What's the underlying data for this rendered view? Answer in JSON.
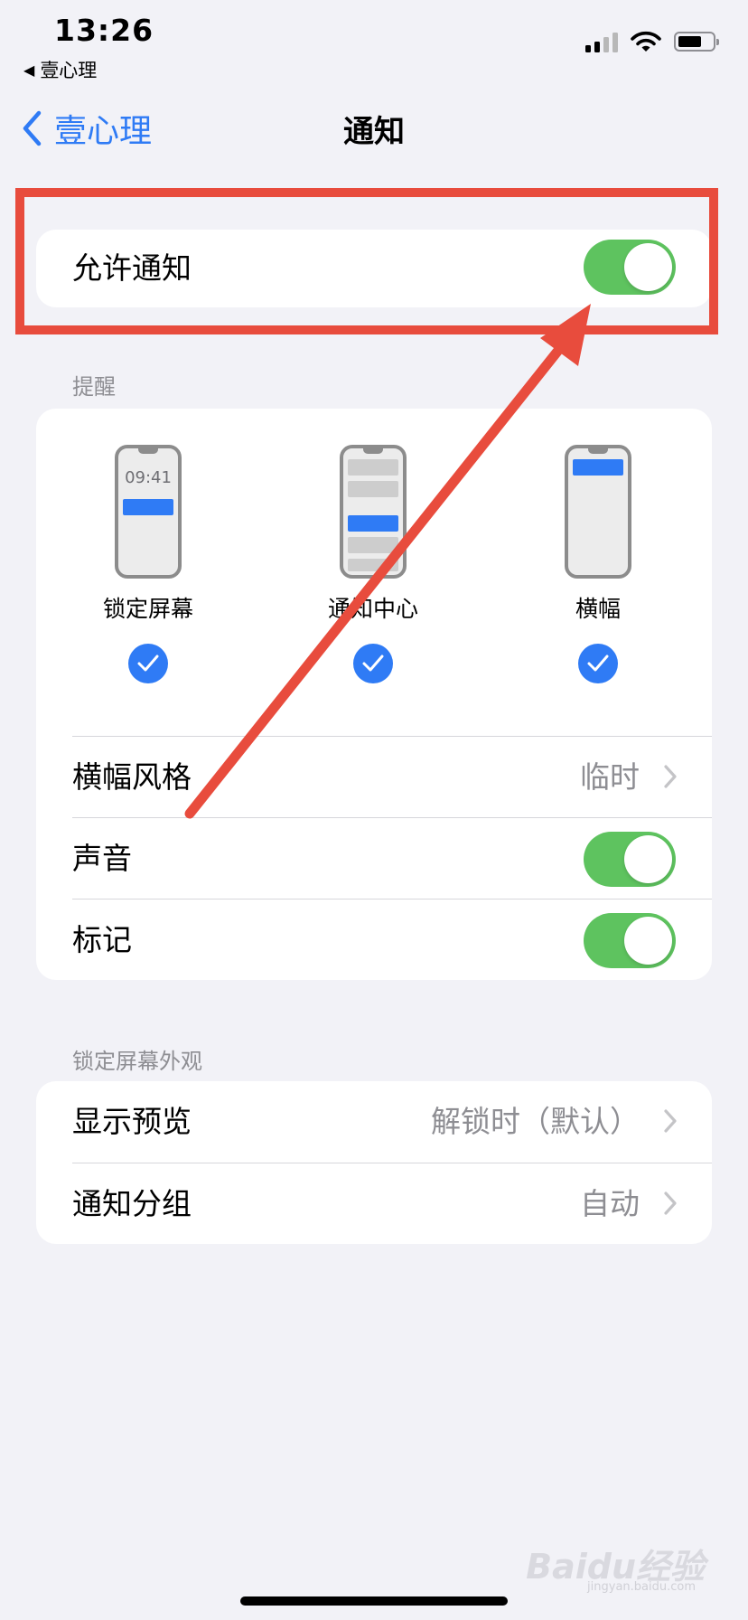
{
  "status_bar": {
    "time": "13:26",
    "back_app": "壹心理"
  },
  "nav": {
    "back_label": "壹心理",
    "title": "通知"
  },
  "allow_notifications": {
    "label": "允许通知",
    "enabled": true
  },
  "alerts": {
    "header": "提醒",
    "options": [
      {
        "label": "锁定屏幕",
        "checked": true,
        "clock": "09:41"
      },
      {
        "label": "通知中心",
        "checked": true
      },
      {
        "label": "横幅",
        "checked": true
      }
    ],
    "banner_style": {
      "label": "横幅风格",
      "value": "临时"
    },
    "sounds": {
      "label": "声音",
      "enabled": true
    },
    "badges": {
      "label": "标记",
      "enabled": true
    }
  },
  "lock_screen": {
    "header": "锁定屏幕外观",
    "show_previews": {
      "label": "显示预览",
      "value": "解锁时（默认）"
    },
    "grouping": {
      "label": "通知分组",
      "value": "自动"
    }
  },
  "watermark": {
    "brand": "Baidu经验",
    "url": "jingyan.baidu.com"
  },
  "colors": {
    "accent": "#2f7bf5",
    "toggle_on": "#5ec35f",
    "annotation": "#e84c3d",
    "background": "#f2f2f7"
  }
}
